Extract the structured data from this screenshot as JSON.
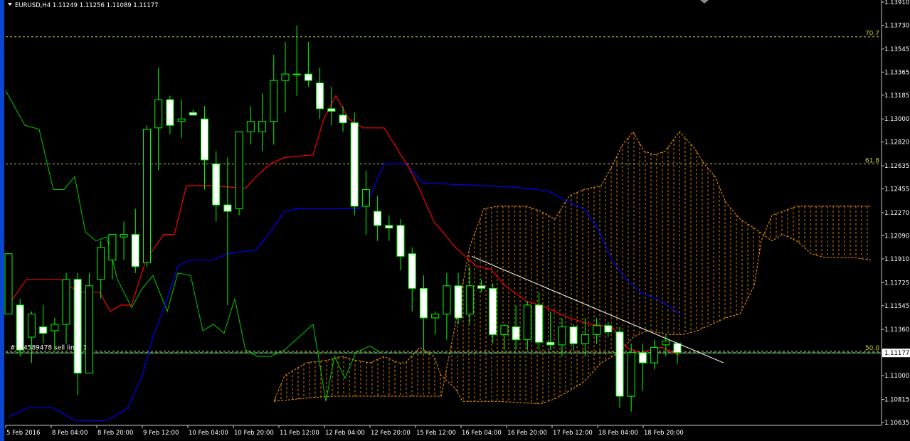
{
  "symbol_header": "EURUSD,H4  1.11249 1.11256 1.11089 1.11177",
  "order_label": "#154589478 sell limit 1.3",
  "current_price_label": "1.11177",
  "colors": {
    "background": "#000000",
    "bull_candle": "#00ff00",
    "bear_candle_fill": "#ffffff",
    "tenkan": "#ff0000",
    "kijun": "#0000ff",
    "chikou": "#00cc00",
    "cloud": "#ff9900",
    "fib_line": "#cccc33",
    "trendline": "#ffffff",
    "order_line": "#00cc00"
  },
  "chart_data": {
    "type": "candlestick",
    "title": "",
    "indicators": [
      "Ichimoku Kinko Hyo",
      "Fibonacci retracement",
      "trendline"
    ],
    "y_ticks": [
      "1.13910",
      "1.13730",
      "1.13545",
      "1.13365",
      "1.13185",
      "1.13000",
      "1.12820",
      "1.12635",
      "1.12455",
      "1.12270",
      "1.12090",
      "1.11910",
      "1.11725",
      "1.11545",
      "1.11360",
      "1.11177",
      "1.11000",
      "1.10815",
      "1.10635"
    ],
    "ylim": [
      1.10635,
      1.1391
    ],
    "x_ticks": [
      "5 Feb 2016",
      "8 Feb 04:00",
      "8 Feb 20:00",
      "9 Feb 12:00",
      "10 Feb 04:00",
      "10 Feb 20:00",
      "11 Feb 12:00",
      "12 Feb 04:00",
      "12 Feb 20:00",
      "15 Feb 12:00",
      "16 Feb 04:00",
      "16 Feb 20:00",
      "17 Feb 12:00",
      "18 Feb 04:00",
      "18 Feb 20:00"
    ],
    "fib_levels": [
      {
        "label": "70.7",
        "price": 1.1364
      },
      {
        "label": "61.8",
        "price": 1.1265
      },
      {
        "label": "50.0",
        "price": 1.1119
      }
    ],
    "order_price": 1.1118,
    "current_price": 1.11177,
    "candles": [
      {
        "o": 1.1148,
        "h": 1.1195,
        "l": 1.1148,
        "c": 1.1195
      },
      {
        "o": 1.1155,
        "h": 1.116,
        "l": 1.1115,
        "c": 1.112
      },
      {
        "o": 1.113,
        "h": 1.115,
        "l": 1.111,
        "c": 1.1148
      },
      {
        "o": 1.1138,
        "h": 1.1155,
        "l": 1.1125,
        "c": 1.1133
      },
      {
        "o": 1.1135,
        "h": 1.1145,
        "l": 1.112,
        "c": 1.114
      },
      {
        "o": 1.114,
        "h": 1.118,
        "l": 1.1125,
        "c": 1.1175
      },
      {
        "o": 1.1175,
        "h": 1.118,
        "l": 1.1085,
        "c": 1.1102
      },
      {
        "o": 1.1102,
        "h": 1.118,
        "l": 1.1102,
        "c": 1.117
      },
      {
        "o": 1.1175,
        "h": 1.1205,
        "l": 1.116,
        "c": 1.12
      },
      {
        "o": 1.119,
        "h": 1.121,
        "l": 1.1175,
        "c": 1.121
      },
      {
        "o": 1.1208,
        "h": 1.122,
        "l": 1.119,
        "c": 1.121
      },
      {
        "o": 1.121,
        "h": 1.123,
        "l": 1.118,
        "c": 1.1185
      },
      {
        "o": 1.1188,
        "h": 1.1295,
        "l": 1.1185,
        "c": 1.1292
      },
      {
        "o": 1.1293,
        "h": 1.134,
        "l": 1.126,
        "c": 1.1315
      },
      {
        "o": 1.1315,
        "h": 1.1318,
        "l": 1.1288,
        "c": 1.1295
      },
      {
        "o": 1.1298,
        "h": 1.1315,
        "l": 1.1285,
        "c": 1.13
      },
      {
        "o": 1.1305,
        "h": 1.1307,
        "l": 1.1303,
        "c": 1.1303
      },
      {
        "o": 1.13,
        "h": 1.131,
        "l": 1.1245,
        "c": 1.1268
      },
      {
        "o": 1.1265,
        "h": 1.1275,
        "l": 1.122,
        "c": 1.1233
      },
      {
        "o": 1.1233,
        "h": 1.127,
        "l": 1.1155,
        "c": 1.1228
      },
      {
        "o": 1.123,
        "h": 1.129,
        "l": 1.1225,
        "c": 1.129
      },
      {
        "o": 1.129,
        "h": 1.131,
        "l": 1.128,
        "c": 1.1298
      },
      {
        "o": 1.129,
        "h": 1.132,
        "l": 1.1275,
        "c": 1.1298
      },
      {
        "o": 1.1298,
        "h": 1.135,
        "l": 1.128,
        "c": 1.133
      },
      {
        "o": 1.133,
        "h": 1.136,
        "l": 1.1305,
        "c": 1.1335
      },
      {
        "o": 1.1335,
        "h": 1.1373,
        "l": 1.1318,
        "c": 1.1335
      },
      {
        "o": 1.1335,
        "h": 1.136,
        "l": 1.1325,
        "c": 1.133
      },
      {
        "o": 1.1328,
        "h": 1.134,
        "l": 1.13,
        "c": 1.1308
      },
      {
        "o": 1.1308,
        "h": 1.1325,
        "l": 1.1295,
        "c": 1.1306
      },
      {
        "o": 1.1303,
        "h": 1.131,
        "l": 1.129,
        "c": 1.1297
      },
      {
        "o": 1.1297,
        "h": 1.1305,
        "l": 1.1225,
        "c": 1.1232
      },
      {
        "o": 1.1232,
        "h": 1.126,
        "l": 1.121,
        "c": 1.1245
      },
      {
        "o": 1.1228,
        "h": 1.124,
        "l": 1.1205,
        "c": 1.1217
      },
      {
        "o": 1.1217,
        "h": 1.1225,
        "l": 1.1205,
        "c": 1.1215
      },
      {
        "o": 1.1217,
        "h": 1.1222,
        "l": 1.1182,
        "c": 1.1193
      },
      {
        "o": 1.1195,
        "h": 1.12,
        "l": 1.115,
        "c": 1.1168
      },
      {
        "o": 1.1168,
        "h": 1.1178,
        "l": 1.112,
        "c": 1.1145
      },
      {
        "o": 1.1145,
        "h": 1.115,
        "l": 1.1132,
        "c": 1.1148
      },
      {
        "o": 1.1148,
        "h": 1.118,
        "l": 1.1128,
        "c": 1.117
      },
      {
        "o": 1.117,
        "h": 1.118,
        "l": 1.114,
        "c": 1.1145
      },
      {
        "o": 1.1148,
        "h": 1.1185,
        "l": 1.114,
        "c": 1.117
      },
      {
        "o": 1.117,
        "h": 1.1175,
        "l": 1.1165,
        "c": 1.1168
      },
      {
        "o": 1.1168,
        "h": 1.1172,
        "l": 1.1125,
        "c": 1.1132
      },
      {
        "o": 1.1132,
        "h": 1.114,
        "l": 1.112,
        "c": 1.1139
      },
      {
        "o": 1.1138,
        "h": 1.1155,
        "l": 1.112,
        "c": 1.1128
      },
      {
        "o": 1.1128,
        "h": 1.1158,
        "l": 1.112,
        "c": 1.1155
      },
      {
        "o": 1.1155,
        "h": 1.1165,
        "l": 1.112,
        "c": 1.1126
      },
      {
        "o": 1.1126,
        "h": 1.115,
        "l": 1.112,
        "c": 1.1124
      },
      {
        "o": 1.1124,
        "h": 1.1145,
        "l": 1.1115,
        "c": 1.1138
      },
      {
        "o": 1.1138,
        "h": 1.114,
        "l": 1.112,
        "c": 1.1125
      },
      {
        "o": 1.1125,
        "h": 1.1145,
        "l": 1.1115,
        "c": 1.1132
      },
      {
        "o": 1.1132,
        "h": 1.1145,
        "l": 1.1125,
        "c": 1.1139
      },
      {
        "o": 1.1139,
        "h": 1.1142,
        "l": 1.113,
        "c": 1.1134
      },
      {
        "o": 1.1134,
        "h": 1.1138,
        "l": 1.1075,
        "c": 1.1084
      },
      {
        "o": 1.1084,
        "h": 1.1125,
        "l": 1.1072,
        "c": 1.1118
      },
      {
        "o": 1.1118,
        "h": 1.1125,
        "l": 1.1088,
        "c": 1.111
      },
      {
        "o": 1.111,
        "h": 1.1128,
        "l": 1.1105,
        "c": 1.1122
      },
      {
        "o": 1.1124,
        "h": 1.1132,
        "l": 1.1115,
        "c": 1.1127
      },
      {
        "o": 1.1125,
        "h": 1.1126,
        "l": 1.1109,
        "c": 1.1118
      }
    ],
    "tenkan": [
      [
        12,
        1.1155
      ],
      [
        37,
        1.1175
      ],
      [
        85,
        1.1175
      ],
      [
        110,
        1.1165
      ],
      [
        140,
        1.1165
      ],
      [
        155,
        1.115
      ],
      [
        170,
        1.1155
      ],
      [
        185,
        1.1155
      ],
      [
        205,
        1.119
      ],
      [
        230,
        1.121
      ],
      [
        245,
        1.121
      ],
      [
        262,
        1.1248
      ],
      [
        300,
        1.1248
      ],
      [
        345,
        1.1246
      ],
      [
        360,
        1.1255
      ],
      [
        380,
        1.1265
      ],
      [
        400,
        1.127
      ],
      [
        440,
        1.1272
      ],
      [
        455,
        1.13
      ],
      [
        472,
        1.1318
      ],
      [
        490,
        1.13
      ],
      [
        510,
        1.1293
      ],
      [
        540,
        1.1293
      ],
      [
        560,
        1.1275
      ],
      [
        575,
        1.1262
      ],
      [
        590,
        1.1245
      ],
      [
        610,
        1.122
      ],
      [
        640,
        1.12
      ],
      [
        670,
        1.1185
      ],
      [
        690,
        1.1183
      ],
      [
        710,
        1.117
      ],
      [
        740,
        1.1158
      ],
      [
        760,
        1.1155
      ],
      [
        800,
        1.1145
      ],
      [
        830,
        1.114
      ],
      [
        860,
        1.1138
      ],
      [
        880,
        1.1122
      ],
      [
        900,
        1.1118
      ],
      [
        930,
        1.1122
      ],
      [
        955,
        1.1116
      ]
    ],
    "kijun": [
      [
        12,
        1.1068
      ],
      [
        40,
        1.1075
      ],
      [
        75,
        1.1075
      ],
      [
        105,
        1.1065
      ],
      [
        150,
        1.1065
      ],
      [
        180,
        1.1075
      ],
      [
        200,
        1.11
      ],
      [
        215,
        1.113
      ],
      [
        235,
        1.116
      ],
      [
        250,
        1.1185
      ],
      [
        265,
        1.119
      ],
      [
        300,
        1.119
      ],
      [
        320,
        1.1195
      ],
      [
        360,
        1.1198
      ],
      [
        380,
        1.1212
      ],
      [
        400,
        1.1228
      ],
      [
        420,
        1.123
      ],
      [
        505,
        1.123
      ],
      [
        520,
        1.124
      ],
      [
        540,
        1.1265
      ],
      [
        570,
        1.1265
      ],
      [
        595,
        1.125
      ],
      [
        720,
        1.1247
      ],
      [
        770,
        1.1244
      ],
      [
        800,
        1.1235
      ],
      [
        820,
        1.123
      ],
      [
        840,
        1.1215
      ],
      [
        860,
        1.119
      ],
      [
        880,
        1.1175
      ],
      [
        900,
        1.1165
      ],
      [
        930,
        1.1158
      ],
      [
        955,
        1.1148
      ]
    ],
    "chikou": [
      [
        8,
        1.1322
      ],
      [
        20,
        1.131
      ],
      [
        35,
        1.1295
      ],
      [
        55,
        1.1292
      ],
      [
        75,
        1.1245
      ],
      [
        90,
        1.1245
      ],
      [
        105,
        1.1255
      ],
      [
        120,
        1.1212
      ],
      [
        135,
        1.1205
      ],
      [
        150,
        1.1208
      ],
      [
        165,
        1.1175
      ],
      [
        185,
        1.1153
      ],
      [
        200,
        1.1168
      ],
      [
        215,
        1.1178
      ],
      [
        235,
        1.115
      ],
      [
        250,
        1.118
      ],
      [
        268,
        1.1178
      ],
      [
        285,
        1.1135
      ],
      [
        300,
        1.114
      ],
      [
        315,
        1.1133
      ],
      [
        330,
        1.116
      ],
      [
        345,
        1.112
      ],
      [
        362,
        1.1115
      ],
      [
        380,
        1.1115
      ],
      [
        400,
        1.112
      ],
      [
        420,
        1.113
      ],
      [
        440,
        1.114
      ],
      [
        458,
        1.108
      ],
      [
        470,
        1.1115
      ],
      [
        485,
        1.1098
      ],
      [
        500,
        1.1118
      ],
      [
        520,
        1.1123
      ],
      [
        535,
        1.1118
      ]
    ],
    "cloud_a": [
      [
        385,
        1.108
      ],
      [
        400,
        1.11
      ],
      [
        430,
        1.111
      ],
      [
        460,
        1.1112
      ],
      [
        480,
        1.1115
      ],
      [
        500,
        1.1112
      ],
      [
        520,
        1.111
      ],
      [
        540,
        1.1115
      ],
      [
        560,
        1.111
      ],
      [
        570,
        1.111
      ],
      [
        590,
        1.1122
      ],
      [
        610,
        1.1115
      ],
      [
        620,
        1.11
      ],
      [
        640,
        1.109
      ],
      [
        650,
        1.108
      ],
      [
        660,
        1.108
      ],
      [
        700,
        1.108
      ],
      [
        760,
        1.1078
      ],
      [
        780,
        1.1082
      ],
      [
        800,
        1.1088
      ],
      [
        820,
        1.1095
      ],
      [
        845,
        1.111
      ],
      [
        870,
        1.1118
      ],
      [
        890,
        1.113
      ],
      [
        910,
        1.1135
      ],
      [
        940,
        1.1132
      ],
      [
        960,
        1.1132
      ],
      [
        980,
        1.1135
      ],
      [
        1000,
        1.114
      ],
      [
        1020,
        1.1145
      ],
      [
        1040,
        1.1148
      ],
      [
        1060,
        1.117
      ],
      [
        1070,
        1.1205
      ],
      [
        1085,
        1.1225
      ],
      [
        1100,
        1.1228
      ],
      [
        1120,
        1.1232
      ],
      [
        1140,
        1.1232
      ],
      [
        1160,
        1.1232
      ],
      [
        1200,
        1.1232
      ],
      [
        1225,
        1.1232
      ]
    ],
    "cloud_b": [
      [
        385,
        1.108
      ],
      [
        440,
        1.1083
      ],
      [
        470,
        1.1084
      ],
      [
        500,
        1.1084
      ],
      [
        540,
        1.1084
      ],
      [
        570,
        1.1084
      ],
      [
        600,
        1.1084
      ],
      [
        620,
        1.1084
      ],
      [
        640,
        1.114
      ],
      [
        660,
        1.12
      ],
      [
        680,
        1.123
      ],
      [
        700,
        1.1232
      ],
      [
        740,
        1.1232
      ],
      [
        760,
        1.1228
      ],
      [
        780,
        1.1222
      ],
      [
        800,
        1.124
      ],
      [
        820,
        1.1245
      ],
      [
        845,
        1.1248
      ],
      [
        860,
        1.1263
      ],
      [
        875,
        1.128
      ],
      [
        890,
        1.129
      ],
      [
        905,
        1.1275
      ],
      [
        920,
        1.1272
      ],
      [
        935,
        1.1275
      ],
      [
        955,
        1.129
      ],
      [
        975,
        1.1278
      ],
      [
        990,
        1.1265
      ],
      [
        1005,
        1.1255
      ],
      [
        1020,
        1.1235
      ],
      [
        1040,
        1.1222
      ],
      [
        1060,
        1.1215
      ],
      [
        1085,
        1.1205
      ],
      [
        1100,
        1.121
      ],
      [
        1120,
        1.1205
      ],
      [
        1140,
        1.1195
      ],
      [
        1160,
        1.1192
      ],
      [
        1200,
        1.1192
      ],
      [
        1225,
        1.119
      ]
    ],
    "trendline": [
      [
        663,
        1.1193
      ],
      [
        1017,
        1.111
      ]
    ]
  }
}
